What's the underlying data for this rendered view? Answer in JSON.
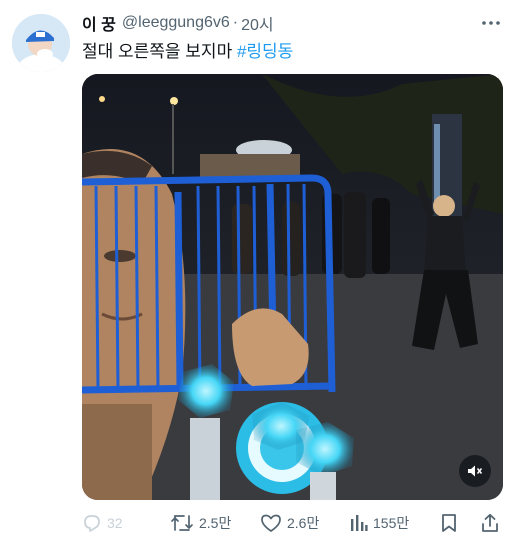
{
  "tweet": {
    "display_name": "이 꿍",
    "handle": "@leeggung6v6",
    "separator": "·",
    "time": "20시",
    "text": "절대 오른쪽을 보지마 ",
    "hashtag": "#링딩동"
  },
  "icons": {
    "more": "more-icon",
    "mute": "volume-mute-icon",
    "reply": "reply-icon",
    "retweet": "retweet-icon",
    "like": "heart-icon",
    "views": "views-icon",
    "bookmark": "bookmark-icon",
    "share": "share-icon"
  },
  "actions": {
    "reply_count": "32",
    "retweet_count": "2.5만",
    "like_count": "2.6만",
    "view_count": "155만"
  },
  "colors": {
    "accent": "#1d9bf0",
    "text": "#0f1419",
    "secondary": "#536471",
    "barrier": "#1f5fd6",
    "lightstick": "#3fd4f5"
  }
}
